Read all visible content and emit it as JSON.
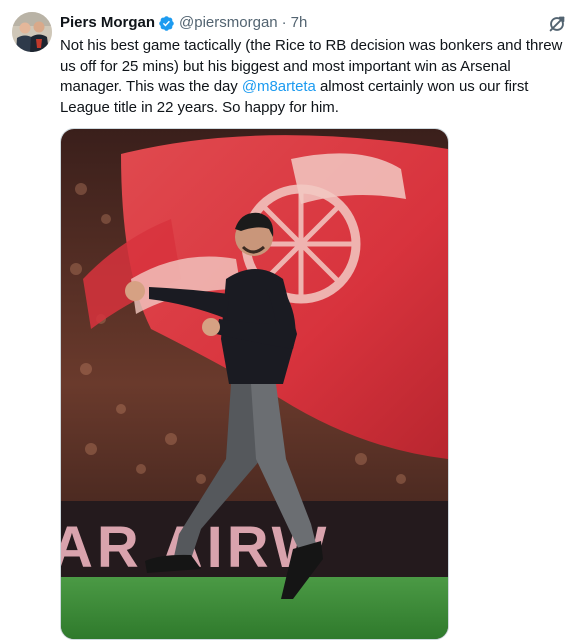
{
  "tweet": {
    "author_name": "Piers Morgan",
    "handle": "@piersmorgan",
    "separator": "·",
    "time": "7h",
    "text_before": "Not his best game tactically  (the Rice to RB decision was bonkers and threw us off for 25 mins) but his biggest and most important win as Arsenal manager. This was the day ",
    "mention": "@m8arteta",
    "text_after": " almost certainly won us our first League title in 22 years. So happy for him.",
    "photo_banner_text": "AR AIRW"
  },
  "icons": {
    "verified": "verified-badge-icon",
    "grok": "grok-icon"
  },
  "colors": {
    "accent": "#1d9bf0",
    "text": "#0f1419",
    "muted": "#536471",
    "flag_red": "#d8333d",
    "pitch": "#3d8a3a"
  }
}
